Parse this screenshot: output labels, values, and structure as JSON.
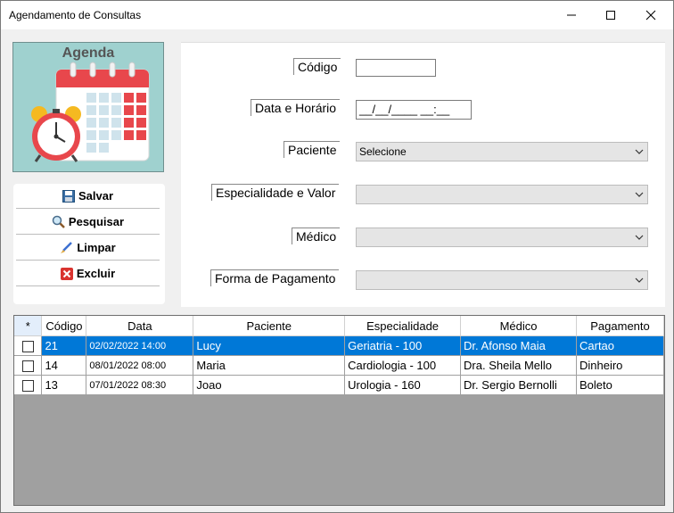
{
  "window": {
    "title": "Agendamento de Consultas"
  },
  "logo": {
    "title": "Agenda"
  },
  "actions": [
    {
      "label": "Salvar",
      "icon": "save-icon"
    },
    {
      "label": "Pesquisar",
      "icon": "search-icon"
    },
    {
      "label": "Limpar",
      "icon": "brush-icon"
    },
    {
      "label": "Excluir",
      "icon": "delete-icon"
    }
  ],
  "form": {
    "codigo_label": "Código",
    "codigo_value": "",
    "data_label": "Data e Horário",
    "data_value": "__/__/____  __:__",
    "paciente_label": "Paciente",
    "paciente_value": "Selecione",
    "especialidade_label": "Especialidade e Valor",
    "especialidade_value": "",
    "medico_label": "Médico",
    "medico_value": "",
    "pagamento_label": "Forma de Pagamento",
    "pagamento_value": ""
  },
  "grid": {
    "columns": [
      "*",
      "Código",
      "Data",
      "Paciente",
      "Especialidade",
      "Médico",
      "Pagamento"
    ],
    "rows": [
      {
        "codigo": "21",
        "data": "02/02/2022 14:00",
        "paciente": "Lucy",
        "especialidade": "Geriatria - 100",
        "medico": "Dr. Afonso Maia",
        "pagamento": "Cartao",
        "selected": true
      },
      {
        "codigo": "14",
        "data": "08/01/2022 08:00",
        "paciente": "Maria",
        "especialidade": "Cardiologia - 100",
        "medico": "Dra. Sheila Mello",
        "pagamento": "Dinheiro",
        "selected": false
      },
      {
        "codigo": "13",
        "data": "07/01/2022 08:30",
        "paciente": "Joao",
        "especialidade": "Urologia - 160",
        "medico": "Dr. Sergio Bernolli",
        "pagamento": "Boleto",
        "selected": false
      }
    ]
  },
  "colors": {
    "selection": "#0078d7",
    "logo_bg": "#9fd1cf",
    "grid_bg": "#a0a0a0"
  }
}
